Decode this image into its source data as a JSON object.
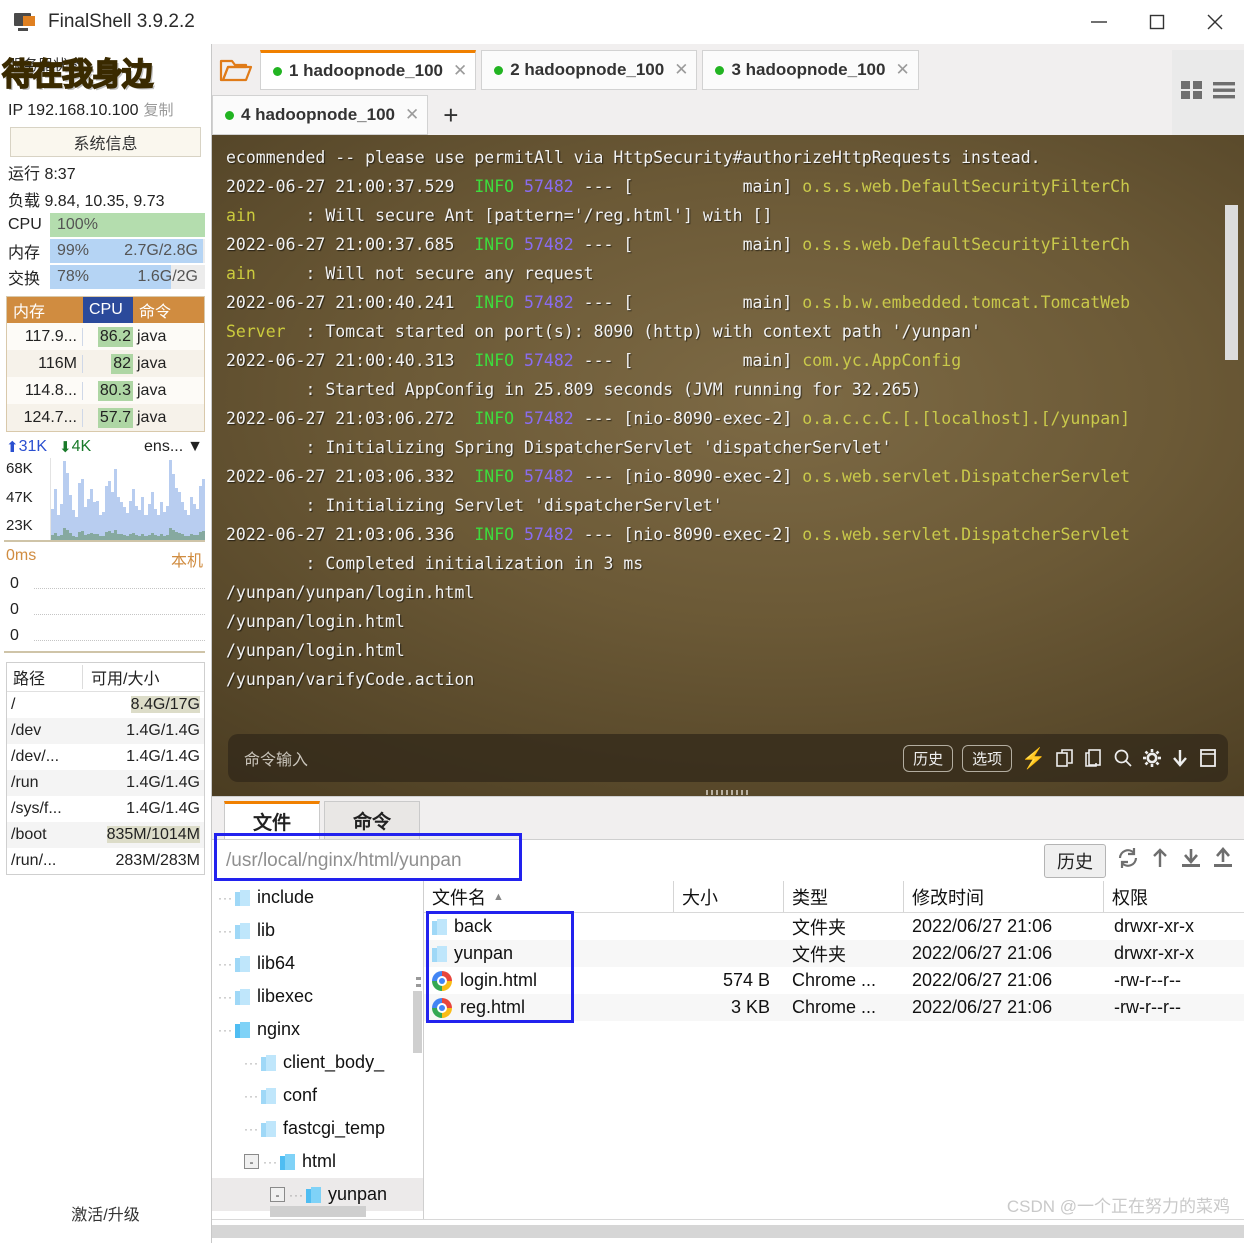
{
  "window": {
    "title": "FinalShell 3.9.2.2",
    "icon": "monitor-icon",
    "minimize": "minimize-icon",
    "maximize": "maximize-icon",
    "close": "close-icon"
  },
  "sidebar": {
    "server_status_label": "服务器状态",
    "overlay_logo": "待在我身边",
    "ip_label": "IP 192.168.10.100",
    "copy_label": "复制",
    "sysinfo_button": "系统信息",
    "uptime": "运行 8:37",
    "load": "负载 9.84, 10.35, 9.73",
    "meters": [
      {
        "label": "CPU",
        "percent": "100%",
        "detail": "",
        "fill": 100,
        "color": "#b4ddae"
      },
      {
        "label": "内存",
        "percent": "99%",
        "detail": "2.7G/2.8G",
        "fill": 99,
        "color": "#b5d4f4"
      },
      {
        "label": "交换",
        "percent": "78%",
        "detail": "1.6G/2G",
        "fill": 78,
        "color": "#b5d4f4"
      }
    ],
    "proc_table": {
      "headers": {
        "mem": "内存",
        "cpu": "CPU",
        "cmd": "命令"
      },
      "rows": [
        {
          "mem": "117.9...",
          "cpu": "86.2",
          "cmd": "java"
        },
        {
          "mem": "116M",
          "cpu": "82",
          "cmd": "java"
        },
        {
          "mem": "114.8...",
          "cpu": "80.3",
          "cmd": "java"
        },
        {
          "mem": "124.7...",
          "cpu": "57.7",
          "cmd": "java"
        }
      ]
    },
    "network": {
      "upload": "31K",
      "download": "4K",
      "interface": "ens...",
      "y_ticks": [
        "68K",
        "47K",
        "23K"
      ]
    },
    "latency": {
      "unit": "0ms",
      "target": "本机",
      "y_ticks": [
        "0",
        "0",
        "0"
      ]
    },
    "disk_table": {
      "headers": {
        "path": "路径",
        "size": "可用/大小"
      },
      "rows": [
        {
          "path": "/",
          "size": "8.4G/17G",
          "highlight": true
        },
        {
          "path": "/dev",
          "size": "1.4G/1.4G",
          "highlight": false
        },
        {
          "path": "/dev/...",
          "size": "1.4G/1.4G",
          "highlight": false
        },
        {
          "path": "/run",
          "size": "1.4G/1.4G",
          "highlight": false
        },
        {
          "path": "/sys/f...",
          "size": "1.4G/1.4G",
          "highlight": false
        },
        {
          "path": "/boot",
          "size": "835M/1014M",
          "highlight": true
        },
        {
          "path": "/run/...",
          "size": "283M/283M",
          "highlight": false
        }
      ]
    },
    "activate_label": "激活/升级"
  },
  "tabbar": {
    "folder_icon": "open-folder-icon",
    "tabs": [
      {
        "label": "1 hadoopnode_100",
        "active": true
      },
      {
        "label": "2 hadoopnode_100",
        "active": false
      },
      {
        "label": "3 hadoopnode_100",
        "active": false
      },
      {
        "label": "4 hadoopnode_100",
        "active": false
      }
    ],
    "add_tab": "+",
    "grid_view_icon": "grid-view-icon",
    "menu_icon": "hamburger-menu-icon"
  },
  "terminal": {
    "lines": [
      [
        {
          "t": "ecommended -- please use permitAll via HttpSecurity#authorizeHttpRequests instead.",
          "c": "tl"
        }
      ],
      [
        {
          "t": "2022-06-27 21:00:37.529  ",
          "c": "tl"
        },
        {
          "t": "INFO",
          "c": "c-info"
        },
        {
          "t": " ",
          "c": "tl"
        },
        {
          "t": "57482",
          "c": "c-pid"
        },
        {
          "t": " --- [           main] ",
          "c": "tl"
        },
        {
          "t": "o.s.s.web.DefaultSecurityFilterCh",
          "c": "c-olive"
        }
      ],
      [
        {
          "t": "ain     ",
          "c": "c-yel"
        },
        {
          "t": ": Will secure Ant [pattern='/reg.html'] with []",
          "c": "tl"
        }
      ],
      [
        {
          "t": "2022-06-27 21:00:37.685  ",
          "c": "tl"
        },
        {
          "t": "INFO",
          "c": "c-info"
        },
        {
          "t": " ",
          "c": "tl"
        },
        {
          "t": "57482",
          "c": "c-pid"
        },
        {
          "t": " --- [           main] ",
          "c": "tl"
        },
        {
          "t": "o.s.s.web.DefaultSecurityFilterCh",
          "c": "c-olive"
        }
      ],
      [
        {
          "t": "ain     ",
          "c": "c-yel"
        },
        {
          "t": ": Will not secure any request",
          "c": "tl"
        }
      ],
      [
        {
          "t": "2022-06-27 21:00:40.241  ",
          "c": "tl"
        },
        {
          "t": "INFO",
          "c": "c-info"
        },
        {
          "t": " ",
          "c": "tl"
        },
        {
          "t": "57482",
          "c": "c-pid"
        },
        {
          "t": " --- [           main] ",
          "c": "tl"
        },
        {
          "t": "o.s.b.w.embedded.tomcat.TomcatWeb",
          "c": "c-olive"
        }
      ],
      [
        {
          "t": "Server  ",
          "c": "c-yel"
        },
        {
          "t": ": Tomcat started on port(s): 8090 (http) with context path '/yunpan'",
          "c": "tl"
        }
      ],
      [
        {
          "t": "2022-06-27 21:00:40.313  ",
          "c": "tl"
        },
        {
          "t": "INFO",
          "c": "c-info"
        },
        {
          "t": " ",
          "c": "tl"
        },
        {
          "t": "57482",
          "c": "c-pid"
        },
        {
          "t": " --- [           main] ",
          "c": "tl"
        },
        {
          "t": "com.yc.AppConfig",
          "c": "c-olive"
        }
      ],
      [
        {
          "t": "        : Started AppConfig in 25.809 seconds (JVM running for 32.265)",
          "c": "tl"
        }
      ],
      [
        {
          "t": "2022-06-27 21:03:06.272  ",
          "c": "tl"
        },
        {
          "t": "INFO",
          "c": "c-info"
        },
        {
          "t": " ",
          "c": "tl"
        },
        {
          "t": "57482",
          "c": "c-pid"
        },
        {
          "t": " --- [nio-8090-exec-2] ",
          "c": "tl"
        },
        {
          "t": "o.a.c.c.C.[.[localhost].[/yunpan]",
          "c": "c-olive"
        }
      ],
      [
        {
          "t": "        : Initializing Spring DispatcherServlet 'dispatcherServlet'",
          "c": "tl"
        }
      ],
      [
        {
          "t": "2022-06-27 21:03:06.332  ",
          "c": "tl"
        },
        {
          "t": "INFO",
          "c": "c-info"
        },
        {
          "t": " ",
          "c": "tl"
        },
        {
          "t": "57482",
          "c": "c-pid"
        },
        {
          "t": " --- [nio-8090-exec-2] ",
          "c": "tl"
        },
        {
          "t": "o.s.web.servlet.DispatcherServlet",
          "c": "c-olive"
        }
      ],
      [
        {
          "t": "        : Initializing Servlet 'dispatcherServlet'",
          "c": "tl"
        }
      ],
      [
        {
          "t": "2022-06-27 21:03:06.336  ",
          "c": "tl"
        },
        {
          "t": "INFO",
          "c": "c-info"
        },
        {
          "t": " ",
          "c": "tl"
        },
        {
          "t": "57482",
          "c": "c-pid"
        },
        {
          "t": " --- [nio-8090-exec-2] ",
          "c": "tl"
        },
        {
          "t": "o.s.web.servlet.DispatcherServlet",
          "c": "c-olive"
        }
      ],
      [
        {
          "t": "        : Completed initialization in 3 ms",
          "c": "tl"
        }
      ],
      [
        {
          "t": "/yunpan/yunpan/login.html",
          "c": "tl"
        }
      ],
      [
        {
          "t": "/yunpan/login.html",
          "c": "tl"
        }
      ],
      [
        {
          "t": "/yunpan/login.html",
          "c": "tl"
        }
      ],
      [
        {
          "t": "/yunpan/varifyCode.action",
          "c": "tl"
        }
      ]
    ],
    "command_placeholder": "命令输入",
    "history_button": "历史",
    "options_button": "选项",
    "icons": [
      "bolt-icon",
      "copy-up-icon",
      "copy-down-icon",
      "search-icon",
      "gear-icon",
      "download-icon",
      "window-icon"
    ]
  },
  "filepanel": {
    "tabs": [
      {
        "label": "文件",
        "active": true
      },
      {
        "label": "命令",
        "active": false
      }
    ],
    "path_value": "/usr/local/nginx/html/yunpan",
    "history_button": "历史",
    "tool_icons": [
      "refresh-icon",
      "up-arrow-icon",
      "download-icon",
      "upload-icon"
    ],
    "tree": [
      {
        "label": "include",
        "depth": 1,
        "expander": "",
        "dark": false,
        "selected": false
      },
      {
        "label": "lib",
        "depth": 1,
        "expander": "",
        "dark": false,
        "selected": false
      },
      {
        "label": "lib64",
        "depth": 1,
        "expander": "",
        "dark": false,
        "selected": false
      },
      {
        "label": "libexec",
        "depth": 1,
        "expander": "",
        "dark": false,
        "selected": false
      },
      {
        "label": "nginx",
        "depth": 1,
        "expander": "",
        "dark": true,
        "selected": false
      },
      {
        "label": "client_body_",
        "depth": 2,
        "expander": "",
        "dark": false,
        "selected": false
      },
      {
        "label": "conf",
        "depth": 2,
        "expander": "",
        "dark": false,
        "selected": false
      },
      {
        "label": "fastcgi_temp",
        "depth": 2,
        "expander": "",
        "dark": false,
        "selected": false
      },
      {
        "label": "html",
        "depth": 2,
        "expander": "-",
        "dark": true,
        "selected": false
      },
      {
        "label": "yunpan",
        "depth": 3,
        "expander": "-",
        "dark": true,
        "selected": true
      }
    ],
    "list_headers": {
      "name": "文件名",
      "size": "大小",
      "type": "类型",
      "mtime": "修改时间",
      "perm": "权限"
    },
    "files": [
      {
        "name": "back",
        "icon": "folder-icon",
        "size": "",
        "type": "文件夹",
        "mtime": "2022/06/27 21:06",
        "perm": "drwxr-xr-x"
      },
      {
        "name": "yunpan",
        "icon": "folder-icon",
        "size": "",
        "type": "文件夹",
        "mtime": "2022/06/27 21:06",
        "perm": "drwxr-xr-x"
      },
      {
        "name": "login.html",
        "icon": "chrome-icon",
        "size": "574 B",
        "type": "Chrome ...",
        "mtime": "2022/06/27 21:06",
        "perm": "-rw-r--r--"
      },
      {
        "name": "reg.html",
        "icon": "chrome-icon",
        "size": "3 KB",
        "type": "Chrome ...",
        "mtime": "2022/06/27 21:06",
        "perm": "-rw-r--r--"
      }
    ]
  },
  "watermark": "CSDN @一个正在努力的菜鸡",
  "colors": {
    "accent": "#f08000",
    "highlight_box": "#2222ee",
    "online_dot": "#22b422",
    "terminal_bg": "#6b5936"
  }
}
